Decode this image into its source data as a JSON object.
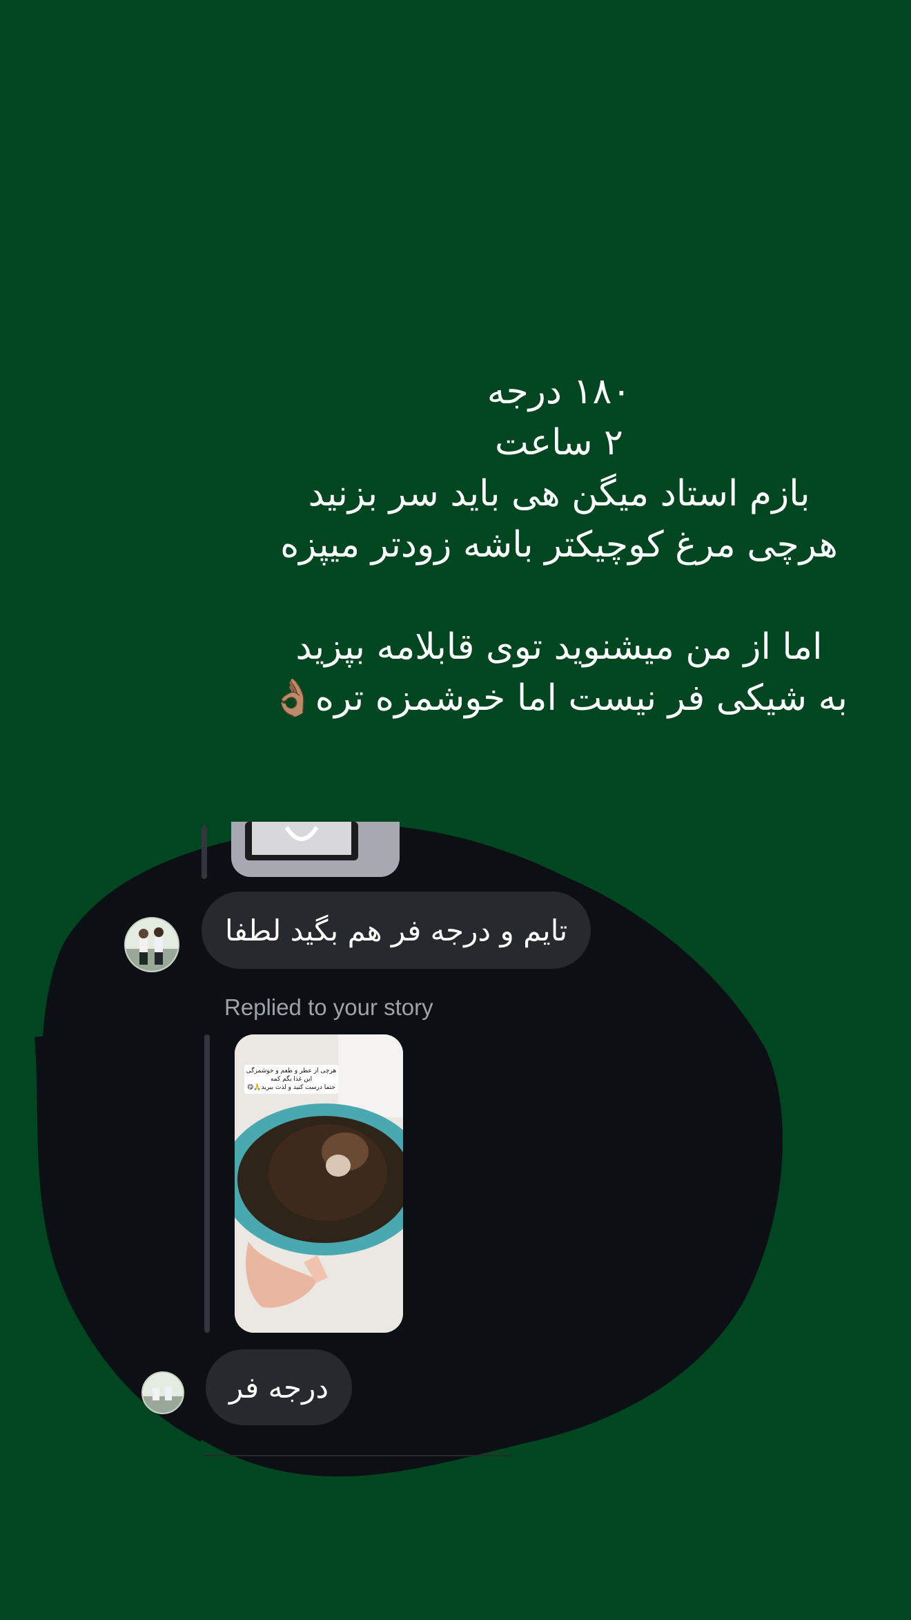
{
  "story": {
    "lines": [
      "۱۸۰ درجه",
      "۲ ساعت",
      "بازم استاد میگن هی باید سر بزنید",
      "هرچی مرغ کوچیکتر باشه زودتر میپزه",
      "اما از من میشنوید توی قابلامه بپزید",
      "به شیکی فر نیست اما خوشمزه تره👌🏽"
    ]
  },
  "dm": {
    "message_1": "تایم و درجه فر هم بگید لطفا",
    "reply_label": "Replied to your story",
    "story_thumb_text": [
      "هرچی از عطر و طعم و خوشمزگی",
      "این غذا بگم کمه",
      "حتما درست کنید و لذت ببرید🙏😋"
    ],
    "message_2": "درجه فر"
  },
  "colors": {
    "background": "#004621",
    "blob": "#0c1014",
    "bubble": "#26292e",
    "text": "#ffffff",
    "muted_text": "#9ea3aa"
  },
  "icons": {
    "emoji": "ok-hand-emoji"
  }
}
